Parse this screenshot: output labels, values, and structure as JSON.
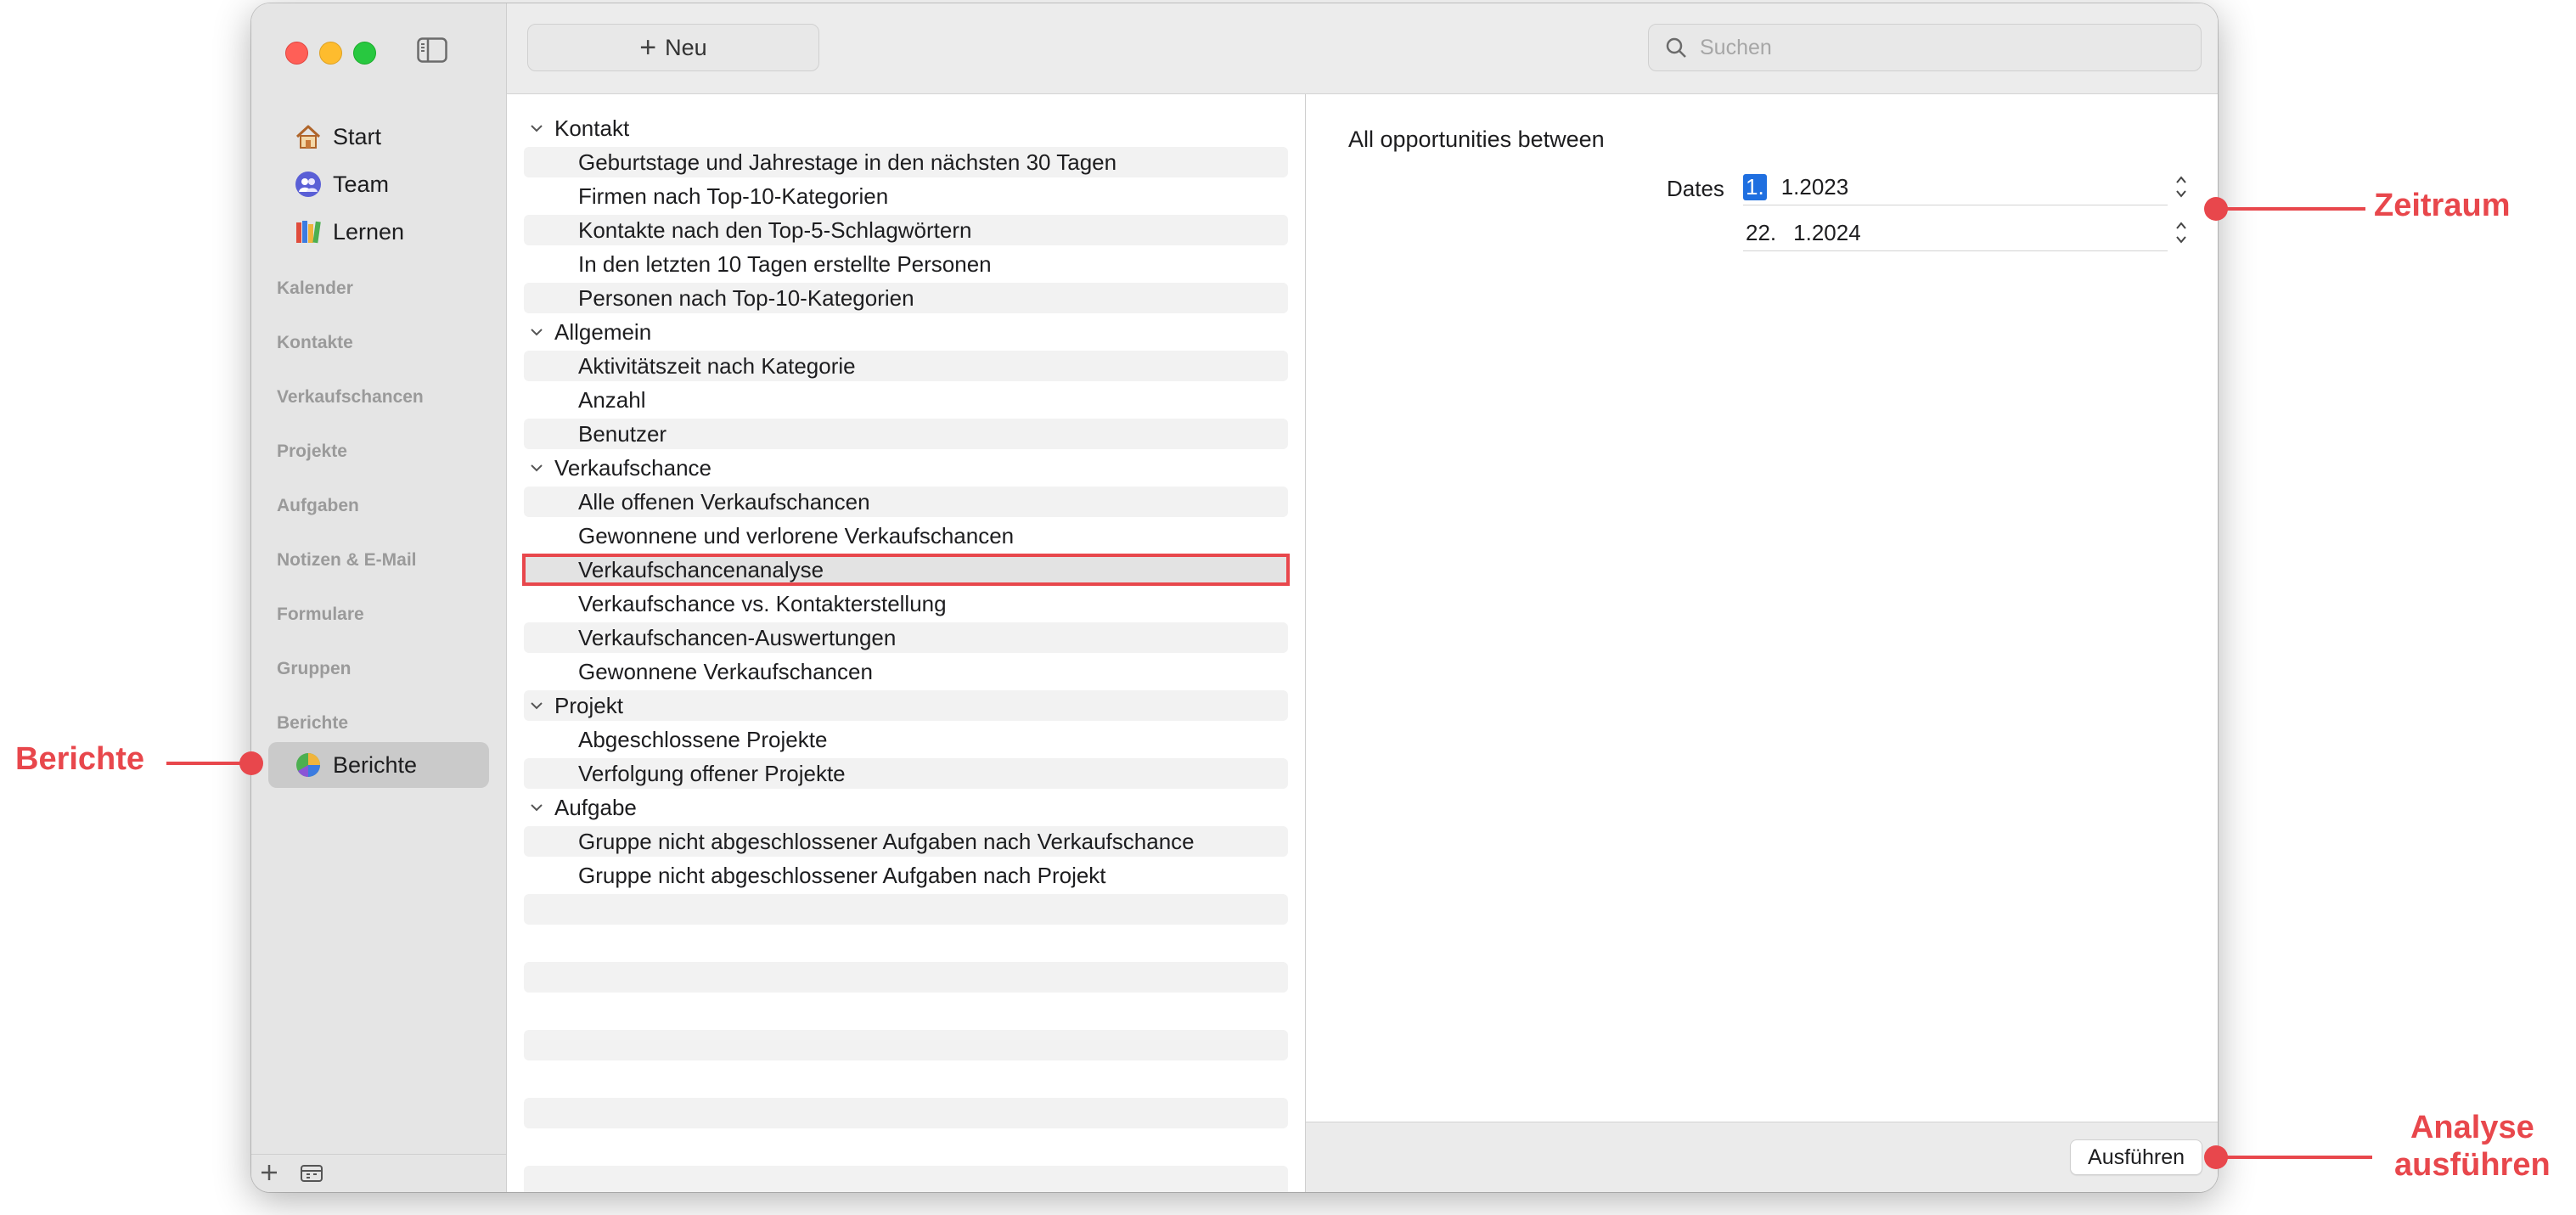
{
  "sidebar": {
    "nav": [
      {
        "label": "Start",
        "icon": "house-icon"
      },
      {
        "label": "Team",
        "icon": "team-icon"
      },
      {
        "label": "Lernen",
        "icon": "books-icon"
      }
    ],
    "sections": [
      "Kalender",
      "Kontakte",
      "Verkaufschancen",
      "Projekte",
      "Aufgaben",
      "Notizen & E-Mail",
      "Formulare",
      "Gruppen",
      "Berichte"
    ],
    "selected_item": {
      "label": "Berichte",
      "icon": "pie-chart-icon"
    }
  },
  "toolbar": {
    "new_label": "Neu",
    "search_placeholder": "Suchen"
  },
  "reports": {
    "groups": [
      {
        "label": "Kontakt",
        "items": [
          "Geburtstage und Jahrestage in den nächsten 30 Tagen",
          "Firmen nach Top-10-Kategorien",
          "Kontakte nach den Top-5-Schlagwörtern",
          "In den letzten 10 Tagen erstellte Personen",
          "Personen nach Top-10-Kategorien"
        ]
      },
      {
        "label": "Allgemein",
        "items": [
          "Aktivitätszeit nach Kategorie",
          "Anzahl",
          "Benutzer"
        ]
      },
      {
        "label": "Verkaufschance",
        "items": [
          "Alle offenen Verkaufschancen",
          "Gewonnene und verlorene Verkaufschancen",
          "Verkaufschancenanalyse",
          "Verkaufschance vs. Kontakterstellung",
          "Verkaufschancen-Auswertungen",
          "Gewonnene Verkaufschancen"
        ]
      },
      {
        "label": "Projekt",
        "items": [
          "Abgeschlossene Projekte",
          "Verfolgung offener Projekte"
        ]
      },
      {
        "label": "Aufgabe",
        "items": [
          "Gruppe nicht abgeschlossener Aufgaben nach Verkaufschance",
          "Gruppe nicht abgeschlossener Aufgaben nach Projekt"
        ]
      }
    ],
    "selected": "Verkaufschancenanalyse"
  },
  "detail": {
    "title": "All opportunities between",
    "dates_label": "Dates",
    "start_date": {
      "day": "1.",
      "rest": "1.2023"
    },
    "end_date": {
      "day": "22.",
      "rest": "1.2024"
    },
    "run_label": "Ausführen"
  },
  "annotations": {
    "berichte": "Berichte",
    "zeitraum": "Zeitraum",
    "analyse_line1": "Analyse",
    "analyse_line2": "ausführen",
    "color": "#e8474c"
  }
}
